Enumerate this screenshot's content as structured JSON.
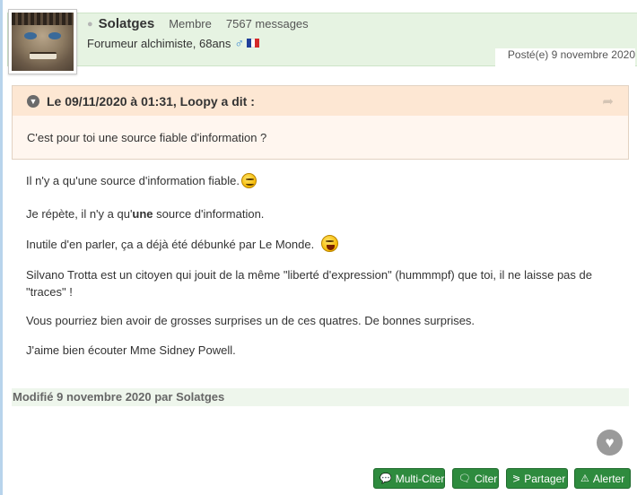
{
  "post": {
    "username": "Solatges",
    "rank": "Membre",
    "message_count": "7567 messages",
    "subtitle": "Forumeur alchimiste, 68ans",
    "date": "Posté(e) 9 novembre 2020"
  },
  "quote": {
    "header": "Le 09/11/2020 à 01:31, Loopy a dit :",
    "text": "C'est pour toi une source fiable d'information ?"
  },
  "content": {
    "p1": "Il n'y a qu'une source d'information fiable.",
    "p2_before": "Je répète, il n'y a qu'",
    "p2_bold": "une",
    "p2_after": " source d'information.",
    "p3": "Inutile d'en parler, ça a déjà été débunké par Le Monde.",
    "p4": "Silvano Trotta est un citoyen qui jouit de la même \"liberté d'expression\" (hummmpf) que toi, il ne laisse pas de \"traces\" !",
    "p5": "Vous pourriez bien avoir de grosses surprises un de ces quatres. De bonnes surprises.",
    "p6": "J'aime bien écouter Mme Sidney Powell."
  },
  "edited": "Modifié 9 novembre 2020 par Solatges",
  "actions": {
    "multi_quote": "Multi-Citer",
    "quote": "Citer",
    "share": "Partager",
    "report": "Alerter"
  },
  "icons": {
    "presence": "user-offline-icon",
    "gender": "male-icon",
    "flag": "france-flag-icon",
    "collapse": "chevron-down-icon",
    "share_quote": "share-arrow-icon",
    "like": "heart-icon"
  },
  "colors": {
    "header_bg": "#e6f3e2",
    "quote_head_bg": "#fde7d3",
    "button_green": "#2e8b3e",
    "edited_bg": "#eef6ec"
  }
}
